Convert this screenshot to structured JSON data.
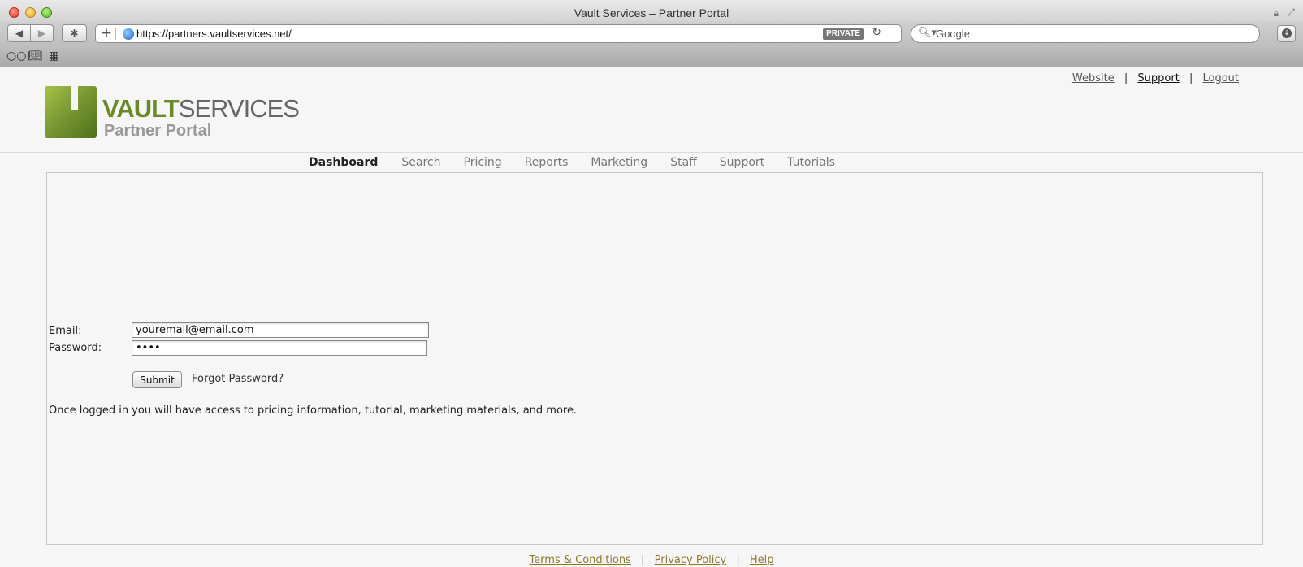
{
  "window": {
    "title": "Vault Services – Partner Portal"
  },
  "toolbar": {
    "back_glyph": "◀",
    "forward_glyph": "▶",
    "extension_glyph": "✱",
    "url": "https://partners.vaultservices.net/",
    "private_label": "PRIVATE",
    "search_placeholder": "Google"
  },
  "icons": {
    "plus": "plus-icon",
    "globe": "globe-icon",
    "reload": "reload-icon",
    "search": "search-icon",
    "download": "download-icon",
    "reading_list": "glasses-icon",
    "bookmarks": "book-icon",
    "top_sites": "grid-icon",
    "lock": "lock-icon",
    "fullscreen": "fullscreen-icon"
  },
  "top_links": {
    "website": "Website",
    "support": "Support",
    "logout": "Logout",
    "separator": "|"
  },
  "logo": {
    "brand_bold": "VAULT",
    "brand_regular": "SERVICES",
    "subtitle": "Partner Portal",
    "brand_color": "#6b8a27"
  },
  "nav": {
    "items": [
      {
        "label": "Dashboard",
        "active": true
      },
      {
        "label": "Search"
      },
      {
        "label": "Pricing"
      },
      {
        "label": "Reports"
      },
      {
        "label": "Marketing"
      },
      {
        "label": "Staff"
      },
      {
        "label": "Support"
      },
      {
        "label": "Tutorials"
      }
    ]
  },
  "login": {
    "email_label": "Email:",
    "email_value": "youremail@email.com",
    "password_label": "Password:",
    "password_value": "••••",
    "submit_label": "Submit",
    "forgot_label": "Forgot Password?",
    "info_text": "Once logged in you will have access to pricing information, tutorial, marketing materials, and more."
  },
  "footer": {
    "terms": "Terms & Conditions",
    "privacy": "Privacy Policy",
    "help": "Help",
    "separator": "|",
    "link_color": "#8b7a2e"
  }
}
